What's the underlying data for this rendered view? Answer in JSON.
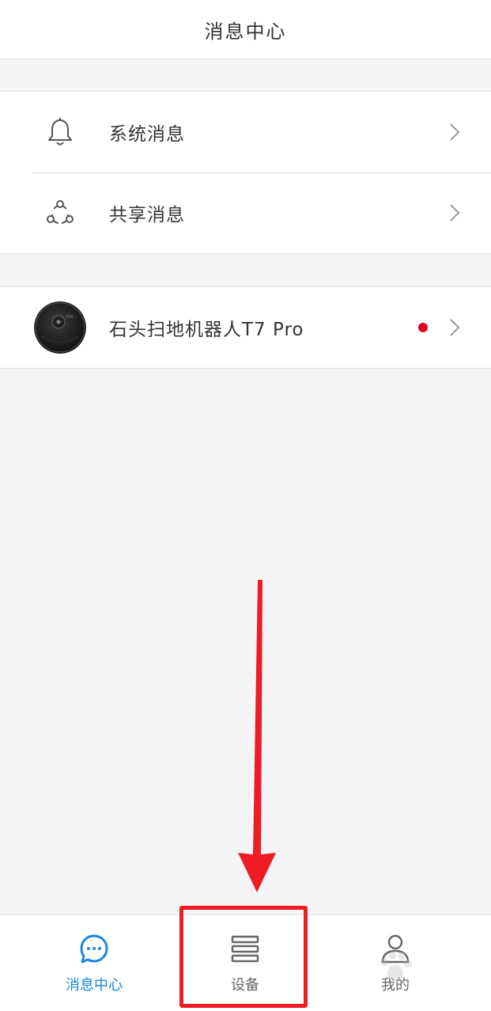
{
  "header": {
    "title": "消息中心"
  },
  "groups": {
    "messages": [
      {
        "label": "系统消息",
        "icon": "bell-icon"
      },
      {
        "label": "共享消息",
        "icon": "share-icon"
      }
    ],
    "devices": [
      {
        "label": "石头扫地机器人T7 Pro",
        "icon": "robot-vacuum-image",
        "unread": true
      }
    ]
  },
  "tabbar": {
    "tabs": [
      {
        "label": "消息中心",
        "icon": "chat-bubble-icon",
        "active": true
      },
      {
        "label": "设备",
        "icon": "device-list-icon",
        "active": false
      },
      {
        "label": "我的",
        "icon": "person-icon",
        "active": false
      }
    ]
  },
  "colors": {
    "accent": "#1a86e0",
    "unread_dot": "#e0001b",
    "annotation": "#ee1c25",
    "background": "#f5f5f7"
  }
}
